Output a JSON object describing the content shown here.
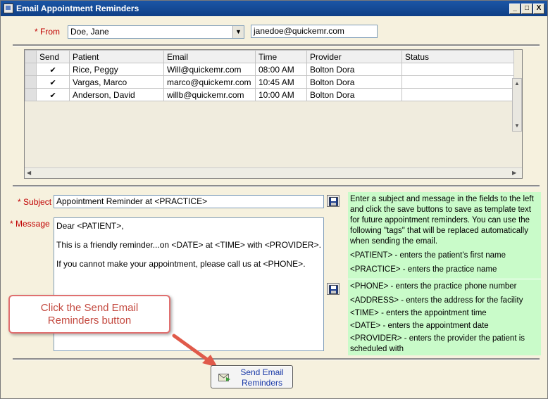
{
  "window": {
    "title": "Email Appointment Reminders",
    "controls": [
      "_",
      "□",
      "X"
    ]
  },
  "from": {
    "label": "From",
    "required_mark": "*",
    "selected": "Doe, Jane",
    "email": "janedoe@quickemr.com"
  },
  "grid": {
    "columns": [
      "Send",
      "Patient",
      "Email",
      "Time",
      "Provider",
      "Status"
    ],
    "rows": [
      {
        "send": "✔",
        "patient": "Rice, Peggy",
        "email": "Will@quickemr.com",
        "time": "08:00 AM",
        "provider": "Bolton Dora",
        "status": ""
      },
      {
        "send": "✔",
        "patient": "Vargas, Marco",
        "email": "marco@quickemr.com",
        "time": "10:45 AM",
        "provider": "Bolton Dora",
        "status": ""
      },
      {
        "send": "✔",
        "patient": "Anderson, David",
        "email": "willb@quickemr.com",
        "time": "10:00 AM",
        "provider": "Bolton Dora",
        "status": ""
      }
    ]
  },
  "subject": {
    "label": "Subject",
    "required_mark": "*",
    "value": "Appointment Reminder at <PRACTICE>"
  },
  "message": {
    "label": "Message",
    "required_mark": "*",
    "lines": [
      "Dear <PATIENT>,",
      "This is a friendly reminder...on <DATE> at <TIME> with <PROVIDER>.",
      "If you cannot make your appointment, please call us at <PHONE>."
    ]
  },
  "help": {
    "intro": "Enter a subject and message in the fields to the left and click the save buttons to save as template text for future appointment reminders. You can use the following \"tags\" that will be replaced automatically when sending the email.",
    "tag_patient": "<PATIENT> - enters the patient's first name",
    "tag_practice": "<PRACTICE> - enters the practice name",
    "tag_phone": "<PHONE> - enters the practice phone number",
    "tag_address": "<ADDRESS> - enters the address for the facility",
    "tag_time": "<TIME> - enters the appointment time",
    "tag_date": "<DATE> - enters the appointment date",
    "tag_provider": "<PROVIDER> - enters the provider the patient is scheduled with"
  },
  "callout": {
    "text": "Click the Send Email Reminders button"
  },
  "send_button": {
    "line1": "Send Email",
    "line2": "Reminders"
  },
  "colors": {
    "titlebar": "#1b56a6",
    "background": "#f6f1de",
    "help_bg": "#c9fbc9",
    "required": "#c00000",
    "callout": "#c44a40",
    "arrow": "#e05a4a"
  },
  "icons": {
    "save": "floppy-disk-icon",
    "send": "envelope-send-icon",
    "dropdown": "chevron-down-icon"
  }
}
